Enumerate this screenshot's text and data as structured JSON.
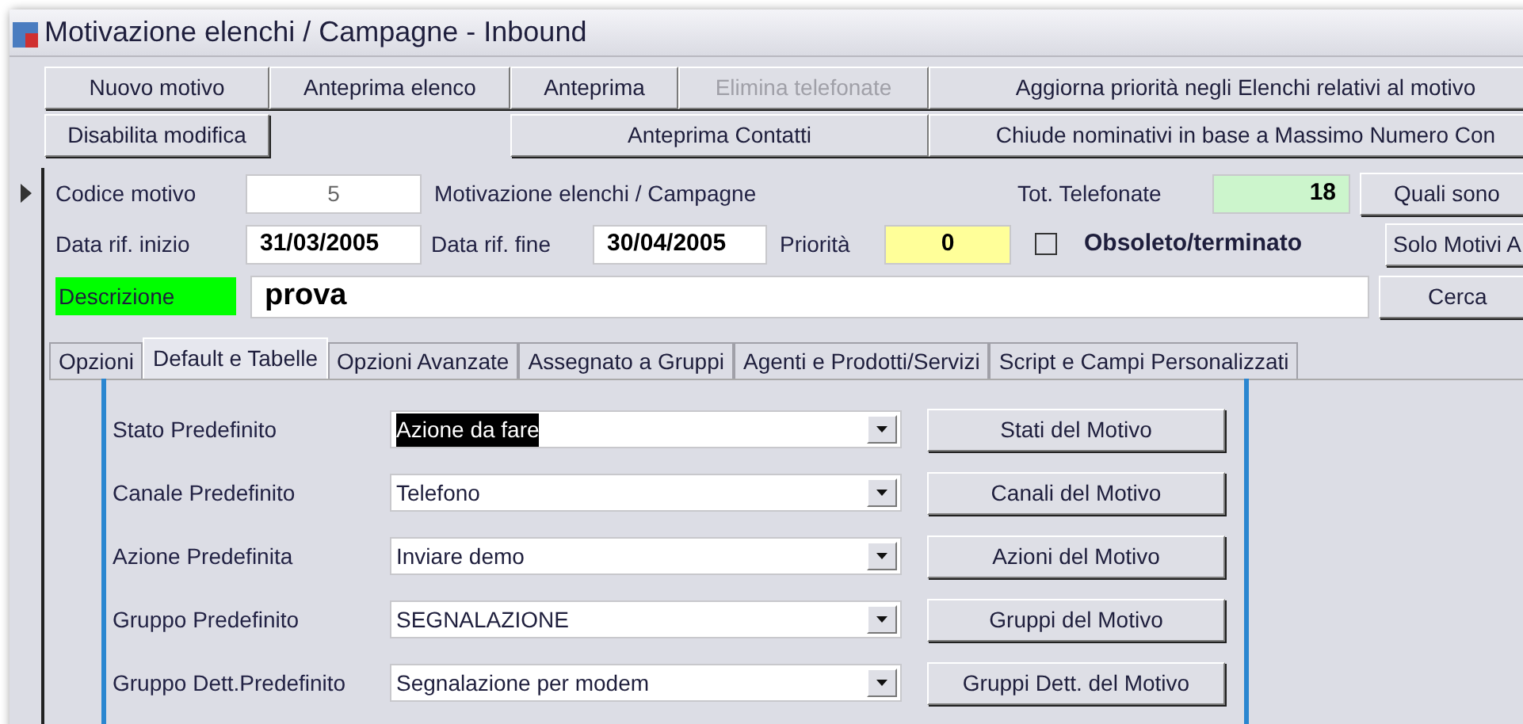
{
  "window": {
    "title": "Motivazione elenchi / Campagne - Inbound"
  },
  "toolbar": {
    "row_1": [
      {
        "label": "Nuovo motivo",
        "disabled": false
      },
      {
        "label": "Anteprima elenco",
        "disabled": false
      },
      {
        "label": "Anteprima",
        "disabled": false
      },
      {
        "label": "Elimina telefonate",
        "disabled": true
      },
      {
        "label": "Aggiorna priorità negli Elenchi relativi al motivo",
        "disabled": false
      }
    ],
    "row_2": [
      {
        "label": "Disabilita modifica",
        "disabled": false
      },
      {
        "label": "Anteprima Contatti",
        "disabled": false
      },
      {
        "label": "Chiude nominativi in base a Massimo Numero Con",
        "disabled": false
      }
    ]
  },
  "form": {
    "codice_label": "Codice motivo",
    "codice_value": "5",
    "table_label": "Motivazione elenchi / Campagne",
    "tot_label": "Tot. Telefonate",
    "tot_value": "18",
    "quali_button": "Quali sono",
    "inizio_label": "Data rif. inizio",
    "inizio_value": "31/03/2005",
    "fine_label": "Data rif. fine",
    "fine_value": "30/04/2005",
    "priorita_label": "Priorità",
    "priorita_value": "0",
    "obsoleto": {
      "label": "Obsoleto/terminato",
      "checked": false
    },
    "solo_button": "Solo Motivi A",
    "descrizione_label": "Descrizione",
    "descrizione_value": "prova",
    "cerca_button": "Cerca"
  },
  "tabs": [
    {
      "label": "Opzioni",
      "selected": false
    },
    {
      "label": "Default e Tabelle",
      "selected": true
    },
    {
      "label": "Opzioni Avanzate",
      "selected": false
    },
    {
      "label": "Assegnato a Gruppi",
      "selected": false
    },
    {
      "label": "Agenti e Prodotti/Servizi",
      "selected": false
    },
    {
      "label": "Script e Campi Personalizzati",
      "selected": false
    }
  ],
  "defaults": [
    {
      "label": "Stato Predefinito",
      "value": "Azione da fare",
      "highlighted": true,
      "button": "Stati del Motivo"
    },
    {
      "label": "Canale Predefinito",
      "value": "Telefono",
      "highlighted": false,
      "button": "Canali del Motivo"
    },
    {
      "label": "Azione Predefinita",
      "value": "Inviare demo",
      "highlighted": false,
      "button": "Azioni del Motivo"
    },
    {
      "label": "Gruppo Predefinito",
      "value": "SEGNALAZIONE",
      "highlighted": false,
      "button": "Gruppi del Motivo"
    },
    {
      "label": "Gruppo Dett.Predefinito",
      "value": "Segnalazione per modem",
      "highlighted": false,
      "button": "Gruppi Dett. del Motivo"
    }
  ]
}
